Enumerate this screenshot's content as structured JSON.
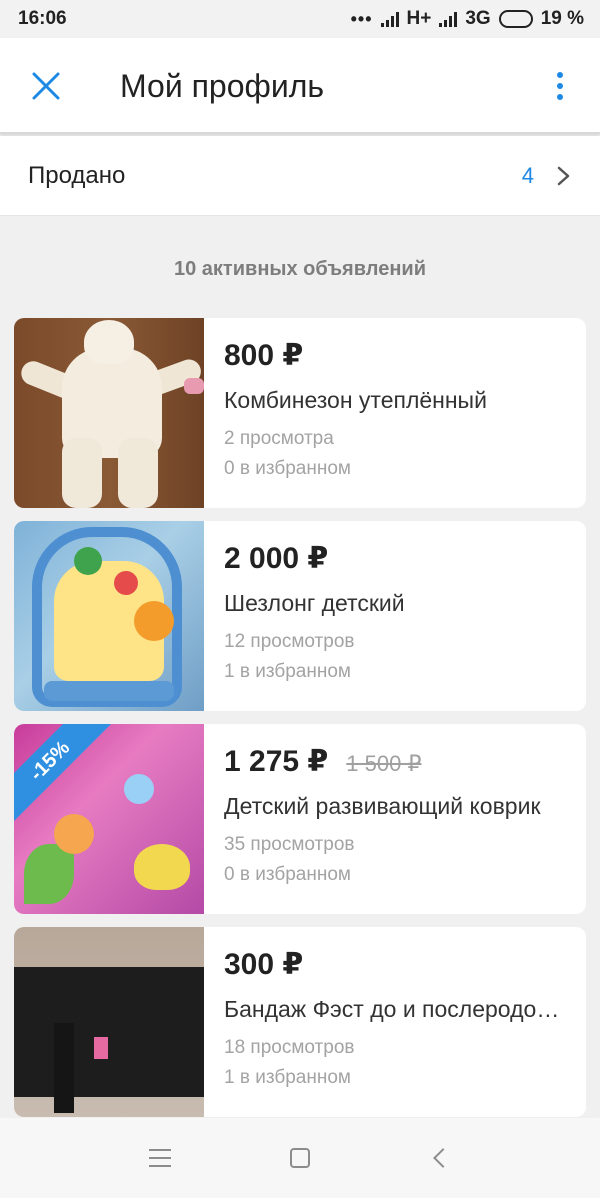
{
  "status_bar": {
    "time": "16:06",
    "dots": "•••",
    "network_1": "H+",
    "network_1_suffix": "ıl",
    "network_2": "3G",
    "battery": "19 %"
  },
  "header": {
    "title": "Мой профиль",
    "close_icon": "close-icon",
    "more_icon": "more-vertical-icon",
    "accent_color": "#1e88e5"
  },
  "sold": {
    "label": "Продано",
    "count": "4"
  },
  "listings_heading": "10 активных объявлений",
  "listings": [
    {
      "price": "800 ₽",
      "old_price": "",
      "title": "Комбинезон утеплённый",
      "views": "2 просмотра",
      "favorites": "0 в избранном"
    },
    {
      "price": "2 000 ₽",
      "old_price": "",
      "title": "Шезлонг детский",
      "views": "12 просмотров",
      "favorites": "1 в избранном"
    },
    {
      "price": "1 275 ₽",
      "old_price": "1 500 ₽",
      "discount": "-15%",
      "title": "Детский развивающий коврик",
      "views": "35 просмотров",
      "favorites": "0 в избранном"
    },
    {
      "price": "300 ₽",
      "old_price": "",
      "title": "Бандаж Фэст до и послеродовой",
      "views": "18 просмотров",
      "favorites": "1 в избранном"
    }
  ],
  "nav": {
    "menu_icon": "menu-icon",
    "home_icon": "home-square-icon",
    "back_icon": "back-icon"
  }
}
